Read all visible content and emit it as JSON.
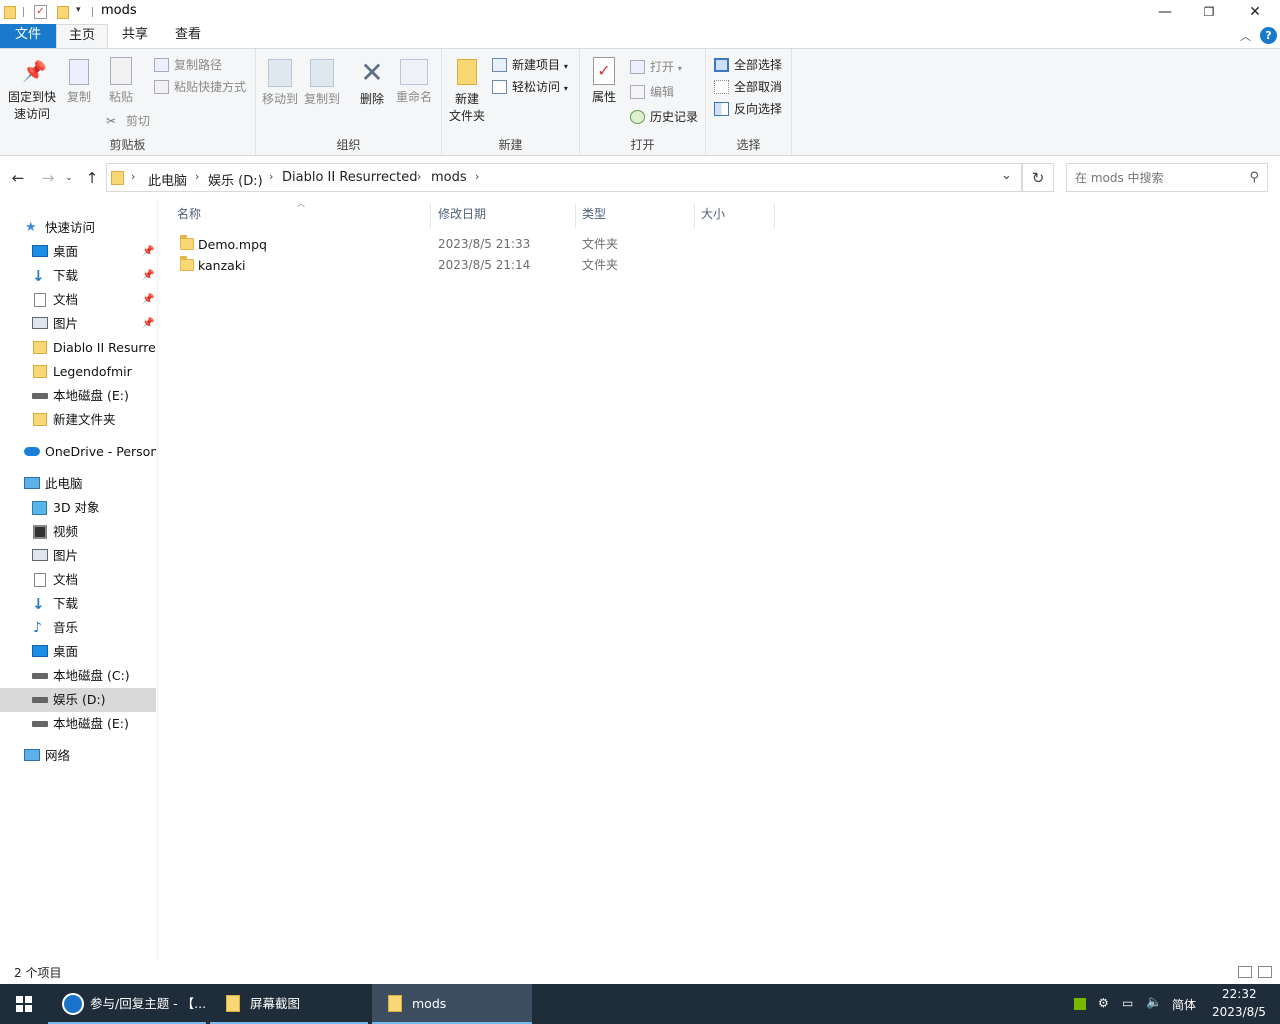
{
  "window": {
    "title": "mods",
    "minimize": "—",
    "restore": "❐",
    "close": "✕"
  },
  "tabs": [
    {
      "label": "文件"
    },
    {
      "label": "主页"
    },
    {
      "label": "共享"
    },
    {
      "label": "查看"
    }
  ],
  "ribbon": {
    "clipboard": {
      "group_label": "剪贴板",
      "pin_quick": "固定到快\n速访问",
      "pin_line1": "固定到快",
      "pin_line2": "速访问",
      "copy": "复制",
      "paste": "粘贴",
      "copy_path": "复制路径",
      "paste_shortcut": "粘贴快捷方式",
      "cut": "剪切"
    },
    "organize": {
      "group_label": "组织",
      "move_to": "移动到",
      "copy_to": "复制到",
      "delete": "删除",
      "rename": "重命名"
    },
    "new": {
      "group_label": "新建",
      "new_folder_line1": "新建",
      "new_folder_line2": "文件夹",
      "new_item": "新建项目",
      "easy_access": "轻松访问"
    },
    "open": {
      "group_label": "打开",
      "properties": "属性",
      "open": "打开",
      "edit": "编辑",
      "history": "历史记录"
    },
    "select": {
      "group_label": "选择",
      "select_all": "全部选择",
      "select_none": "全部取消",
      "invert": "反向选择"
    }
  },
  "address": {
    "crumbs": [
      "此电脑",
      "娱乐 (D:)",
      "Diablo II Resurrected",
      "mods"
    ],
    "search_placeholder": "在 mods 中搜索"
  },
  "sidebar": {
    "quick_access": "快速访问",
    "quick_items": [
      {
        "label": "桌面",
        "pinned": true,
        "icon": "desktop-icon"
      },
      {
        "label": "下载",
        "pinned": true,
        "icon": "download-icon"
      },
      {
        "label": "文档",
        "pinned": true,
        "icon": "document-icon"
      },
      {
        "label": "图片",
        "pinned": true,
        "icon": "picture-icon"
      },
      {
        "label": "Diablo II Resurrected",
        "icon": "folder-icon"
      },
      {
        "label": "Legendofmir",
        "icon": "folder-icon"
      },
      {
        "label": "本地磁盘 (E:)",
        "icon": "drive-icon"
      },
      {
        "label": "新建文件夹",
        "icon": "folder-icon"
      }
    ],
    "onedrive": "OneDrive - Personal",
    "this_pc": "此电脑",
    "pc_items": [
      {
        "label": "3D 对象",
        "icon": "3d-objects-icon"
      },
      {
        "label": "视频",
        "icon": "video-icon"
      },
      {
        "label": "图片",
        "icon": "picture-icon"
      },
      {
        "label": "文档",
        "icon": "document-icon"
      },
      {
        "label": "下载",
        "icon": "download-icon"
      },
      {
        "label": "音乐",
        "icon": "music-icon"
      },
      {
        "label": "桌面",
        "icon": "desktop-icon"
      },
      {
        "label": "本地磁盘 (C:)",
        "icon": "drive-icon"
      },
      {
        "label": "娱乐 (D:)",
        "icon": "drive-icon",
        "selected": true
      },
      {
        "label": "本地磁盘 (E:)",
        "icon": "drive-icon"
      }
    ],
    "network": "网络"
  },
  "columns": [
    "名称",
    "修改日期",
    "类型",
    "大小"
  ],
  "files": [
    {
      "name": "Demo.mpq",
      "date": "2023/8/5 21:33",
      "type": "文件夹"
    },
    {
      "name": "kanzaki",
      "date": "2023/8/5 21:14",
      "type": "文件夹"
    }
  ],
  "status": "2 个项目",
  "taskbar": {
    "apps": [
      {
        "label": "参与/回复主题 - 【...",
        "icon": "browser-icon"
      },
      {
        "label": "屏幕截图",
        "icon": "folder-icon"
      },
      {
        "label": "mods",
        "icon": "folder-icon",
        "active": true
      }
    ],
    "ime": "简体",
    "time": "22:32",
    "date": "2023/8/5"
  },
  "colors": {
    "file_tab": "#1979ca",
    "ribbon_bg": "#f5f6f7",
    "taskbar": "#1f2d3a",
    "selected_nav": "#d9d9d9",
    "folder": "#f8d775"
  }
}
